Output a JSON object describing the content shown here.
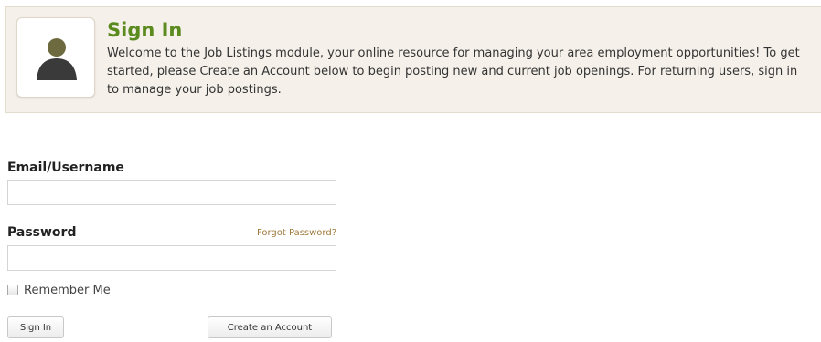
{
  "intro": {
    "avatar_icon": "user-silhouette-icon",
    "title": "Sign In",
    "text": "Welcome to the Job Listings module, your online resource for managing your area employment opportunities! To get started, please Create an Account below to begin posting new and current job openings. For returning users, sign in to manage your job postings."
  },
  "form": {
    "email_label": "Email/Username",
    "email_value": "",
    "email_placeholder": "",
    "password_label": "Password",
    "password_value": "",
    "password_placeholder": "",
    "forgot_password": "Forgot Password?",
    "remember_me": "Remember Me",
    "remember_checked": false,
    "sign_in_button": "Sign In",
    "create_account_button": "Create an Account"
  },
  "colors": {
    "title_green": "#5b8a1f",
    "panel_background": "#f5f1ea",
    "link_brown": "#a07a3c",
    "avatar_head": "#6e6a3f",
    "avatar_body": "#3a3a3a"
  }
}
